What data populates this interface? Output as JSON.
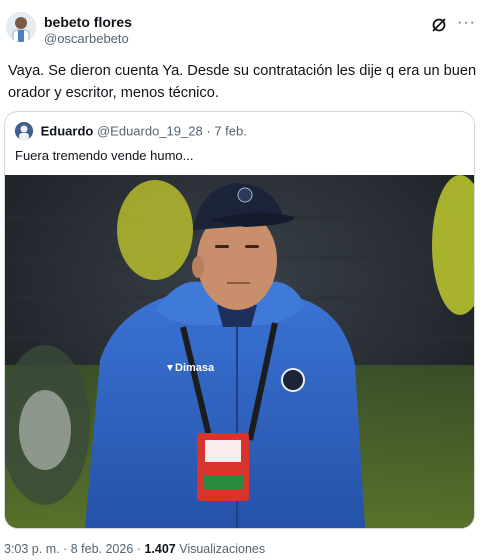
{
  "author": {
    "display_name": "bebeto flores",
    "handle": "@oscarbebeto"
  },
  "actions": {
    "more_label": "···"
  },
  "tweet": {
    "text": "Vaya. Se dieron cuenta Ya. Desde su contratación les dije q era un buen orador y escritor, menos técnico."
  },
  "quote": {
    "display_name": "Eduardo",
    "handle": "@Eduardo_19_28",
    "separator": "·",
    "date": "7 feb.",
    "text": "Fuera tremendo vende humo...",
    "image_text": {
      "brand": "Dimasa"
    }
  },
  "footer": {
    "time": "3:03 p. m.",
    "separator1": "·",
    "date": "8 feb. 2026",
    "separator2": "·",
    "views_count": "1.407",
    "views_label": "Visualizaciones"
  },
  "colors": {
    "text_primary": "#0f1419",
    "text_secondary": "#536471",
    "border": "#cfd9de",
    "jacket_blue": "#2f63c4",
    "cap_navy": "#1b2438",
    "lanyard_badge": "#d8342c"
  }
}
